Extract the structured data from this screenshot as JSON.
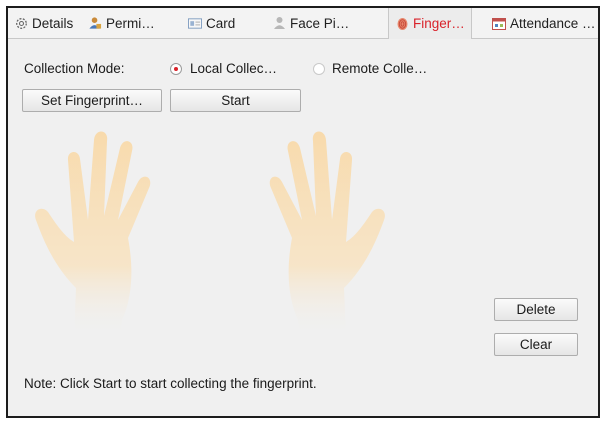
{
  "tabs": [
    {
      "label": "Details",
      "icon": "gear-icon",
      "active": false
    },
    {
      "label": "Permi…",
      "icon": "user-permission-icon",
      "active": false
    },
    {
      "label": "Card",
      "icon": "card-icon",
      "active": false
    },
    {
      "label": "Face Pi…",
      "icon": "face-person-icon",
      "active": false
    },
    {
      "label": "Finger…",
      "icon": "fingerprint-icon",
      "active": true
    },
    {
      "label": "Attendance …",
      "icon": "calendar-icon",
      "active": false
    }
  ],
  "collection": {
    "mode_label": "Collection Mode:",
    "local_label": "Local Collec…",
    "remote_label": "Remote Colle…",
    "selected": "local"
  },
  "buttons": {
    "set_fingerprint": "Set Fingerprint…",
    "start": "Start",
    "delete": "Delete",
    "clear": "Clear"
  },
  "note": "Note: Click Start to start collecting the fingerprint.",
  "colors": {
    "accent": "#d9222a",
    "hand": "#f8d9a8"
  }
}
